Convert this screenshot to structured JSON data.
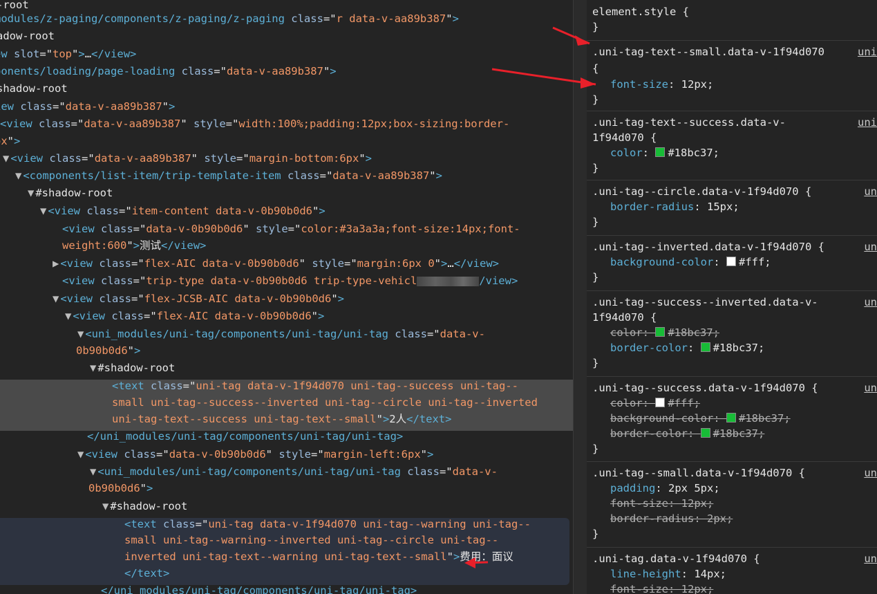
{
  "dom_panel": {
    "lines": [
      {
        "segs": [
          [
            "shadow",
            "-root"
          ]
        ]
      },
      {
        "segs": [
          [
            "tag",
            "modules/z-paging/components/z-paging/z-paging "
          ],
          [
            "attr",
            "class"
          ],
          [
            "txt",
            "=\""
          ],
          [
            "val",
            "r data-v-aa89b387"
          ],
          [
            "txt",
            "\""
          ],
          [
            "tag",
            ">"
          ]
        ]
      },
      {
        "segs": [
          [
            "shadow",
            "adow-root"
          ]
        ]
      },
      {
        "segs": [
          [
            "tag",
            "ew "
          ],
          [
            "attr",
            "slot"
          ],
          [
            "txt",
            "=\""
          ],
          [
            "val",
            "top"
          ],
          [
            "txt",
            "\""
          ],
          [
            "tag",
            ">"
          ],
          [
            "txt",
            "…"
          ],
          [
            "tag",
            "</view>"
          ]
        ]
      },
      {
        "segs": [
          [
            "tag",
            "ponents/loading/page-loading "
          ],
          [
            "attr",
            "class"
          ],
          [
            "txt",
            "=\""
          ],
          [
            "val",
            "data-v-aa89b387"
          ],
          [
            "txt",
            "\""
          ],
          [
            "tag",
            ">"
          ]
        ]
      },
      {
        "segs": [
          [
            "shadow",
            "shadow-root"
          ]
        ]
      },
      {
        "segs": [
          [
            "tag",
            "iew "
          ],
          [
            "attr",
            "class"
          ],
          [
            "txt",
            "=\""
          ],
          [
            "val",
            "data-v-aa89b387"
          ],
          [
            "txt",
            "\""
          ],
          [
            "tag",
            ">"
          ]
        ]
      },
      {
        "segs": [
          [
            "tag",
            "<view "
          ],
          [
            "attr",
            "class"
          ],
          [
            "txt",
            "=\""
          ],
          [
            "val",
            "data-v-aa89b387"
          ],
          [
            "txt",
            "\" "
          ],
          [
            "attr",
            "style"
          ],
          [
            "txt",
            "=\""
          ],
          [
            "val",
            "width:100%;padding:12px;box-sizing:border-"
          ]
        ]
      },
      {
        "segs": [
          [
            "val",
            "ox"
          ],
          [
            "txt",
            "\""
          ],
          [
            "tag",
            ">"
          ]
        ]
      },
      {
        "segs": [
          [
            "tri",
            "▼"
          ],
          [
            "tag",
            "<view "
          ],
          [
            "attr",
            "class"
          ],
          [
            "txt",
            "=\""
          ],
          [
            "val",
            "data-v-aa89b387"
          ],
          [
            "txt",
            "\" "
          ],
          [
            "attr",
            "style"
          ],
          [
            "txt",
            "=\""
          ],
          [
            "val",
            "margin-bottom:6px"
          ],
          [
            "txt",
            "\""
          ],
          [
            "tag",
            ">"
          ]
        ]
      },
      {
        "segs": [
          [
            "tri",
            "▼"
          ],
          [
            "tag",
            "<components/list-item/trip-template-item "
          ],
          [
            "attr",
            "class"
          ],
          [
            "txt",
            "=\""
          ],
          [
            "val",
            "data-v-aa89b387"
          ],
          [
            "txt",
            "\""
          ],
          [
            "tag",
            ">"
          ]
        ]
      },
      {
        "segs": [
          [
            "tri",
            "▼"
          ],
          [
            "shadow",
            "#shadow-root"
          ]
        ]
      },
      {
        "segs": [
          [
            "tri",
            "▼"
          ],
          [
            "tag",
            "<view "
          ],
          [
            "attr",
            "class"
          ],
          [
            "txt",
            "=\""
          ],
          [
            "val",
            "item-content data-v-0b90b0d6"
          ],
          [
            "txt",
            "\""
          ],
          [
            "tag",
            ">"
          ]
        ]
      },
      {
        "segs": [
          [
            "tag",
            "<view "
          ],
          [
            "attr",
            "class"
          ],
          [
            "txt",
            "=\""
          ],
          [
            "val",
            "data-v-0b90b0d6"
          ],
          [
            "txt",
            "\" "
          ],
          [
            "attr",
            "style"
          ],
          [
            "txt",
            "=\""
          ],
          [
            "val",
            "color:#3a3a3a;font-size:14px;font-"
          ]
        ]
      },
      {
        "segs": [
          [
            "val",
            "weight:600"
          ],
          [
            "txt",
            "\""
          ],
          [
            "tag",
            ">"
          ],
          [
            "txt",
            "测试"
          ],
          [
            "tag",
            "</view>"
          ]
        ]
      },
      {
        "segs": [
          [
            "tri",
            "▶"
          ],
          [
            "tag",
            "<view "
          ],
          [
            "attr",
            "class"
          ],
          [
            "txt",
            "=\""
          ],
          [
            "val",
            "flex-AIC data-v-0b90b0d6"
          ],
          [
            "txt",
            "\" "
          ],
          [
            "attr",
            "style"
          ],
          [
            "txt",
            "=\""
          ],
          [
            "val",
            "margin:6px 0"
          ],
          [
            "txt",
            "\""
          ],
          [
            "tag",
            ">"
          ],
          [
            "txt",
            "…"
          ],
          [
            "tag",
            "</view>"
          ]
        ]
      },
      {
        "segs": [
          [
            "tag",
            "<view "
          ],
          [
            "attr",
            "class"
          ],
          [
            "txt",
            "=\""
          ],
          [
            "val",
            "trip-type data-v-0b90b0d6 trip-type-vehicl"
          ],
          [
            "blur",
            ""
          ],
          [
            "tag",
            "/view>"
          ]
        ]
      },
      {
        "segs": [
          [
            "tri",
            "▼"
          ],
          [
            "tag",
            "<view "
          ],
          [
            "attr",
            "class"
          ],
          [
            "txt",
            "=\""
          ],
          [
            "val",
            "flex-JCSB-AIC data-v-0b90b0d6"
          ],
          [
            "txt",
            "\""
          ],
          [
            "tag",
            ">"
          ]
        ]
      },
      {
        "segs": [
          [
            "tri",
            "▼"
          ],
          [
            "tag",
            "<view "
          ],
          [
            "attr",
            "class"
          ],
          [
            "txt",
            "=\""
          ],
          [
            "val",
            "flex-AIC data-v-0b90b0d6"
          ],
          [
            "txt",
            "\""
          ],
          [
            "tag",
            ">"
          ]
        ]
      },
      {
        "segs": [
          [
            "tri",
            "▼"
          ],
          [
            "tag",
            "<uni_modules/uni-tag/components/uni-tag/uni-tag "
          ],
          [
            "attr",
            "class"
          ],
          [
            "txt",
            "=\""
          ],
          [
            "val",
            "data-v-"
          ]
        ]
      },
      {
        "segs": [
          [
            "val",
            "0b90b0d6"
          ],
          [
            "txt",
            "\""
          ],
          [
            "tag",
            ">"
          ]
        ]
      },
      {
        "segs": [
          [
            "tri",
            "▼"
          ],
          [
            "shadow",
            "#shadow-root"
          ]
        ]
      },
      {
        "segs": [
          [
            "tag",
            "<text "
          ],
          [
            "attr",
            "class"
          ],
          [
            "txt",
            "=\""
          ],
          [
            "val",
            "uni-tag data-v-1f94d070 uni-tag--success uni-tag--"
          ]
        ]
      },
      {
        "segs": [
          [
            "val",
            "small uni-tag--success--inverted uni-tag--circle uni-tag--inverted"
          ]
        ]
      },
      {
        "segs": [
          [
            "val",
            "uni-tag-text--success uni-tag-text--small"
          ],
          [
            "txt",
            "\""
          ],
          [
            "tag",
            ">"
          ],
          [
            "txt",
            "2人"
          ],
          [
            "tag",
            "</text>"
          ]
        ]
      },
      {
        "segs": [
          [
            "tag",
            "</uni_modules/uni-tag/components/uni-tag/uni-tag>"
          ]
        ]
      },
      {
        "segs": [
          [
            "tri",
            "▼"
          ],
          [
            "tag",
            "<view "
          ],
          [
            "attr",
            "class"
          ],
          [
            "txt",
            "=\""
          ],
          [
            "val",
            "data-v-0b90b0d6"
          ],
          [
            "txt",
            "\" "
          ],
          [
            "attr",
            "style"
          ],
          [
            "txt",
            "=\""
          ],
          [
            "val",
            "margin-left:6px"
          ],
          [
            "txt",
            "\""
          ],
          [
            "tag",
            ">"
          ]
        ]
      },
      {
        "segs": [
          [
            "tri",
            "▼"
          ],
          [
            "tag",
            "<uni_modules/uni-tag/components/uni-tag/uni-tag "
          ],
          [
            "attr",
            "class"
          ],
          [
            "txt",
            "=\""
          ],
          [
            "val",
            "data-v-"
          ]
        ]
      },
      {
        "segs": [
          [
            "val",
            "0b90b0d6"
          ],
          [
            "txt",
            "\""
          ],
          [
            "tag",
            ">"
          ]
        ]
      },
      {
        "segs": [
          [
            "tri",
            "▼"
          ],
          [
            "shadow",
            "#shadow-root"
          ]
        ]
      },
      {
        "segs": [
          [
            "tag",
            "<text "
          ],
          [
            "attr",
            "class"
          ],
          [
            "txt",
            "=\""
          ],
          [
            "val",
            "uni-tag data-v-1f94d070 uni-tag--warning uni-tag--"
          ]
        ]
      },
      {
        "segs": [
          [
            "val",
            "small uni-tag--warning--inverted uni-tag--circle uni-tag--"
          ]
        ]
      },
      {
        "segs": [
          [
            "val",
            "inverted uni-tag-text--warning uni-tag-text--small"
          ],
          [
            "txt",
            "\""
          ],
          [
            "tag",
            ">"
          ],
          [
            "txt",
            "费用：面议"
          ]
        ]
      },
      {
        "segs": [
          [
            "tag",
            "</text>"
          ]
        ]
      },
      {
        "segs": [
          [
            "tag",
            "</uni_modules/uni-tag/components/uni-tag/uni-tag>"
          ]
        ]
      }
    ]
  },
  "styles_panel": {
    "rules": [
      {
        "selector": [
          "element.style {"
        ],
        "source": "",
        "decls": [],
        "close": "}"
      },
      {
        "selector": [
          ".uni-tag-text--small.data-v-1f94d070",
          "{"
        ],
        "source": "uni",
        "decls": [
          {
            "prop": "font-size",
            "value": "12px;",
            "strike": false
          }
        ],
        "close": "}"
      },
      {
        "selector": [
          ".uni-tag-text--success.data-v-",
          "1f94d070 {"
        ],
        "source": "uni",
        "decls": [
          {
            "prop": "color",
            "value": "#18bc37;",
            "strike": false,
            "swatch": "#18bc37"
          }
        ],
        "close": "}"
      },
      {
        "selector": [
          ".uni-tag--circle.data-v-1f94d070 {"
        ],
        "source": "un",
        "decls": [
          {
            "prop": "border-radius",
            "value": "15px;",
            "strike": false
          }
        ],
        "close": "}"
      },
      {
        "selector": [
          ".uni-tag--inverted.data-v-1f94d070 {"
        ],
        "source": "un",
        "decls": [
          {
            "prop": "background-color",
            "value": "#fff;",
            "strike": false,
            "swatch": "#ffffff"
          }
        ],
        "close": "}"
      },
      {
        "selector": [
          ".uni-tag--success--inverted.data-v-",
          "1f94d070 {"
        ],
        "source": "un",
        "decls": [
          {
            "prop": "color",
            "value": "#18bc37;",
            "strike": true,
            "swatch": "#18bc37"
          },
          {
            "prop": "border-color",
            "value": "#18bc37;",
            "strike": false,
            "swatch": "#18bc37"
          }
        ],
        "close": "}"
      },
      {
        "selector": [
          ".uni-tag--success.data-v-1f94d070 {"
        ],
        "source": "un",
        "decls": [
          {
            "prop": "color",
            "value": "#fff;",
            "strike": true,
            "swatch": "#ffffff"
          },
          {
            "prop": "background-color",
            "value": "#18bc37;",
            "strike": true,
            "swatch": "#18bc37"
          },
          {
            "prop": "border-color",
            "value": "#18bc37;",
            "strike": true,
            "swatch": "#18bc37"
          }
        ],
        "close": "}"
      },
      {
        "selector": [
          ".uni-tag--small.data-v-1f94d070 {"
        ],
        "source": "un",
        "decls": [
          {
            "prop": "padding",
            "value": "2px 5px;",
            "strike": false
          },
          {
            "prop": "font-size",
            "value": "12px;",
            "strike": true
          },
          {
            "prop": "border-radius",
            "value": "2px;",
            "strike": true
          }
        ],
        "close": "}"
      },
      {
        "selector": [
          ".uni-tag.data-v-1f94d070 {"
        ],
        "source": "un",
        "decls": [
          {
            "prop": "line-height",
            "value": "14px;",
            "strike": false
          },
          {
            "prop": "font-size",
            "value": "12px;",
            "strike": true
          }
        ],
        "close": ""
      }
    ]
  },
  "colors": {
    "arrow": "#e8202a",
    "success": "#18bc37"
  }
}
